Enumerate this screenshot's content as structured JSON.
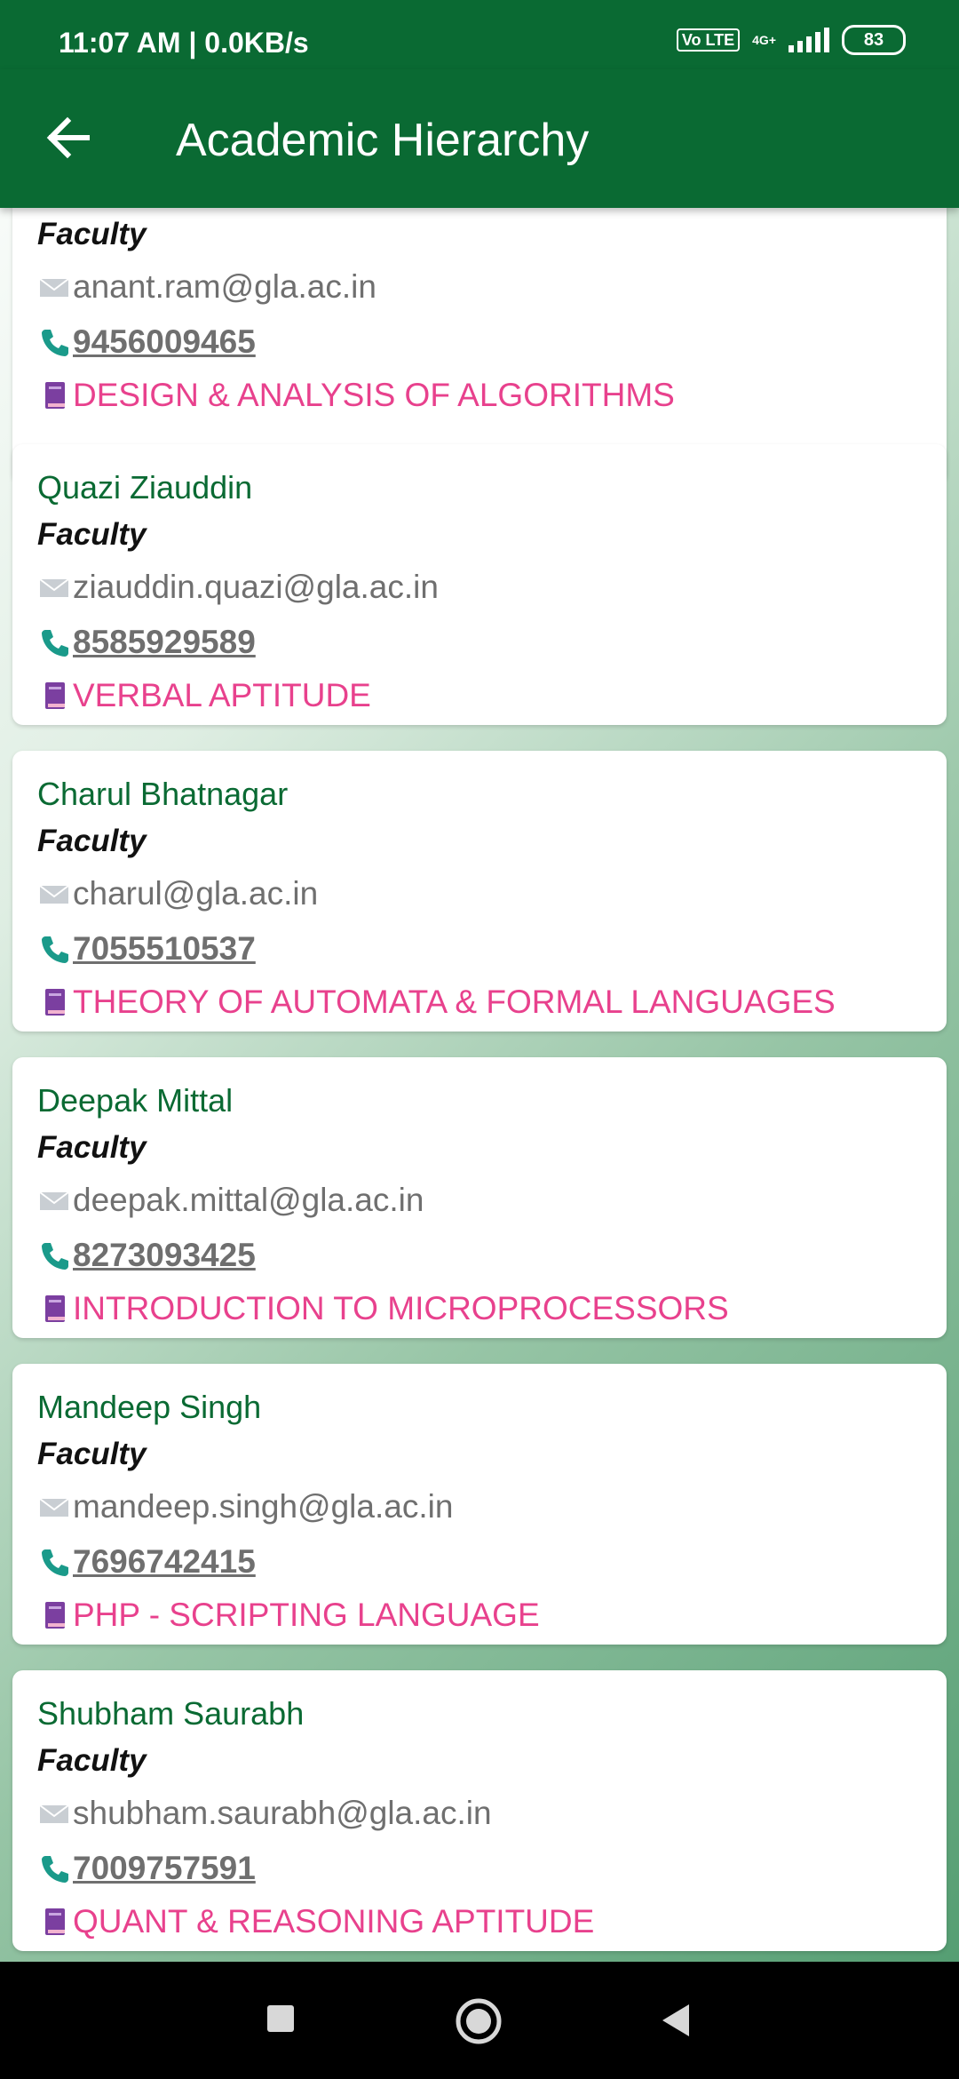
{
  "status_bar": {
    "time": "11:07 AM | 0.0KB/s",
    "volte": "Vo LTE",
    "network": "4G+",
    "battery": "83"
  },
  "app_bar": {
    "title": "Academic Hierarchy"
  },
  "faculty": [
    {
      "name": "",
      "role": "Faculty",
      "email": "anant.ram@gla.ac.in",
      "phone": "9456009465",
      "subject": "DESIGN & ANALYSIS OF ALGORITHMS"
    },
    {
      "name": "Quazi Ziauddin",
      "role": "Faculty",
      "email": "ziauddin.quazi@gla.ac.in",
      "phone": "8585929589",
      "subject": "VERBAL APTITUDE"
    },
    {
      "name": "Charul Bhatnagar",
      "role": "Faculty",
      "email": "charul@gla.ac.in",
      "phone": "7055510537",
      "subject": "THEORY OF AUTOMATA & FORMAL LANGUAGES"
    },
    {
      "name": "Deepak Mittal",
      "role": "Faculty",
      "email": "deepak.mittal@gla.ac.in",
      "phone": "8273093425",
      "subject": "INTRODUCTION TO MICROPROCESSORS"
    },
    {
      "name": "Mandeep Singh",
      "role": "Faculty",
      "email": "mandeep.singh@gla.ac.in",
      "phone": "7696742415",
      "subject": "PHP - SCRIPTING LANGUAGE"
    },
    {
      "name": "Shubham Saurabh",
      "role": "Faculty",
      "email": "shubham.saurabh@gla.ac.in",
      "phone": "7009757591",
      "subject": "QUANT & REASONING APTITUDE"
    }
  ],
  "icons": {
    "email": "mail-icon",
    "phone": "phone-icon",
    "subject": "book-icon",
    "back": "back-arrow-icon"
  },
  "colors": {
    "primary": "#0a6a33",
    "subject": "#e8418d",
    "phone_icon": "#1a9a8a",
    "book_icon": "#7b3fa0"
  }
}
